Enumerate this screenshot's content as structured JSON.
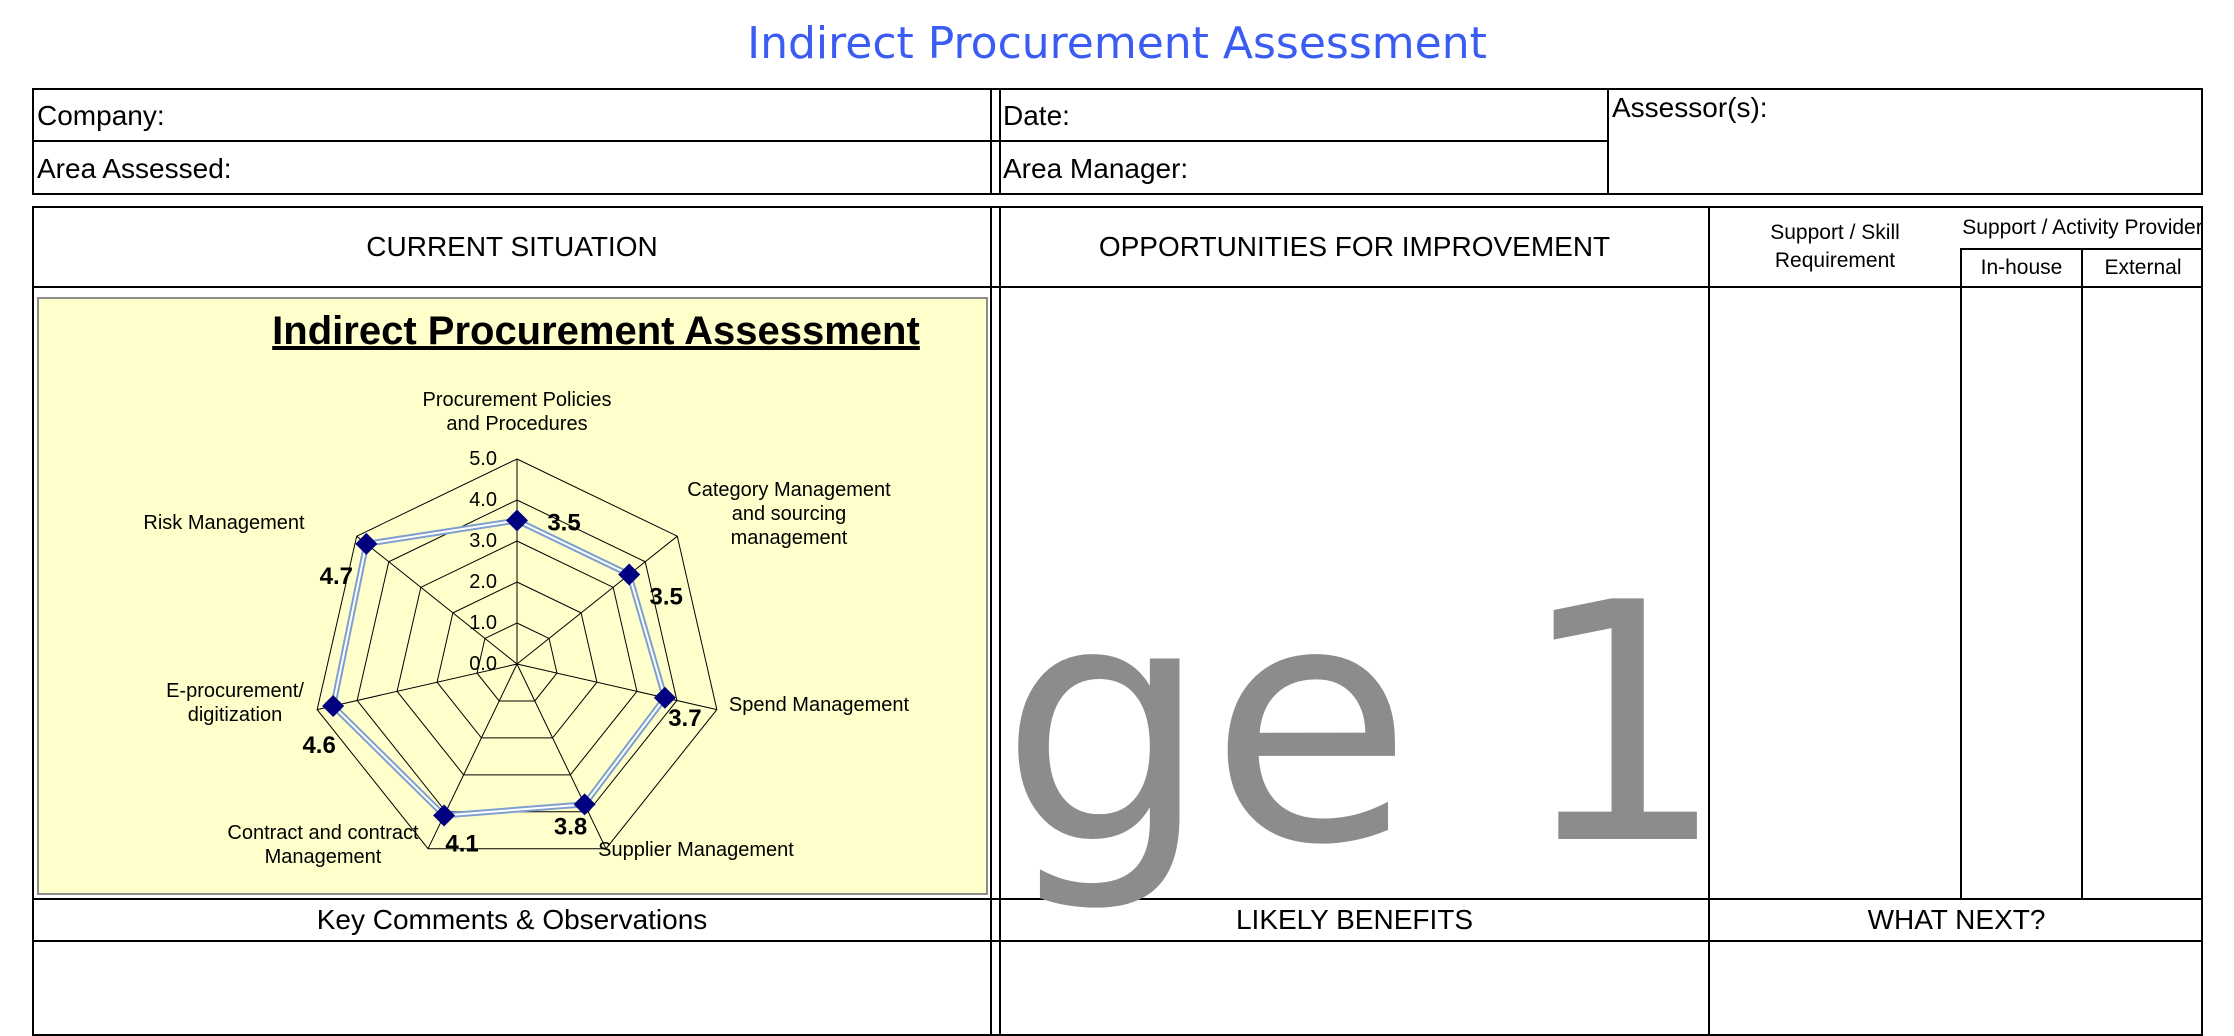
{
  "page_title": "Indirect Procurement Assessment",
  "header_fields": {
    "company": "Company:",
    "date": "Date:",
    "assessors": "Assessor(s):",
    "area_assessed": "Area Assessed:",
    "area_manager": "Area Manager:"
  },
  "sections": {
    "current_situation": "CURRENT SITUATION",
    "opportunities": "OPPORTUNITIES FOR IMPROVEMENT",
    "support_skill": "Support / Skill Requirement",
    "support_provider": "Support / Activity Provider",
    "in_house": "In-house",
    "external": "External",
    "key_comments": "Key Comments & Observations",
    "likely_benefits": "LIKELY BENEFITS",
    "what_next": "WHAT NEXT?"
  },
  "watermark": "ge 1",
  "chart_data": {
    "type": "radar",
    "title": "Indirect Procurement Assessment",
    "categories": [
      "Procurement Policies and Procedures",
      "Category Management and sourcing management",
      "Spend Management",
      "Supplier Management",
      "Contract and contract Management",
      "E-procurement/ digitization",
      "Risk Management"
    ],
    "category_lines": [
      [
        "Procurement Policies",
        "and Procedures"
      ],
      [
        "Category Management",
        "and sourcing",
        "management"
      ],
      [
        "Spend Management"
      ],
      [
        "Supplier Management"
      ],
      [
        "Contract and contract",
        "Management"
      ],
      [
        "E-procurement/",
        "digitization"
      ],
      [
        "Risk Management"
      ]
    ],
    "values": [
      3.5,
      3.5,
      3.7,
      3.8,
      4.1,
      4.6,
      4.7
    ],
    "value_labels": [
      "3.5",
      "3.5",
      "3.7",
      "3.8",
      "4.1",
      "4.6",
      "4.7"
    ],
    "range": [
      0,
      5
    ],
    "ticks": [
      "0.0",
      "1.0",
      "2.0",
      "3.0",
      "4.0",
      "5.0"
    ],
    "marker_color": "#000080",
    "line_color": "#7f9fcf",
    "grid": true,
    "legend": "none"
  }
}
